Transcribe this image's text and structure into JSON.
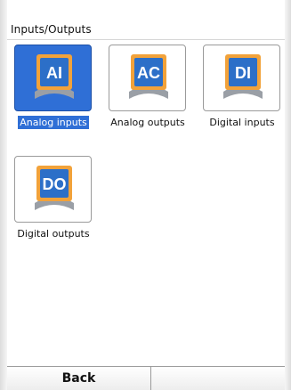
{
  "header": {
    "title": "Inputs/Outputs"
  },
  "tiles": [
    {
      "code": "AI",
      "label": "Analog inputs",
      "selected": true
    },
    {
      "code": "AC",
      "label": "Analog outputs",
      "selected": false
    },
    {
      "code": "DI",
      "label": "Digital inputs",
      "selected": false
    },
    {
      "code": "DO",
      "label": "Digital outputs",
      "selected": false
    }
  ],
  "bottom_bar": {
    "back_label": "Back"
  },
  "colors": {
    "selection": "#2f6fd6",
    "icon_badge": "#2c6fc8",
    "icon_orange": "#f2a23a",
    "icon_grey": "#9a9fa6"
  }
}
